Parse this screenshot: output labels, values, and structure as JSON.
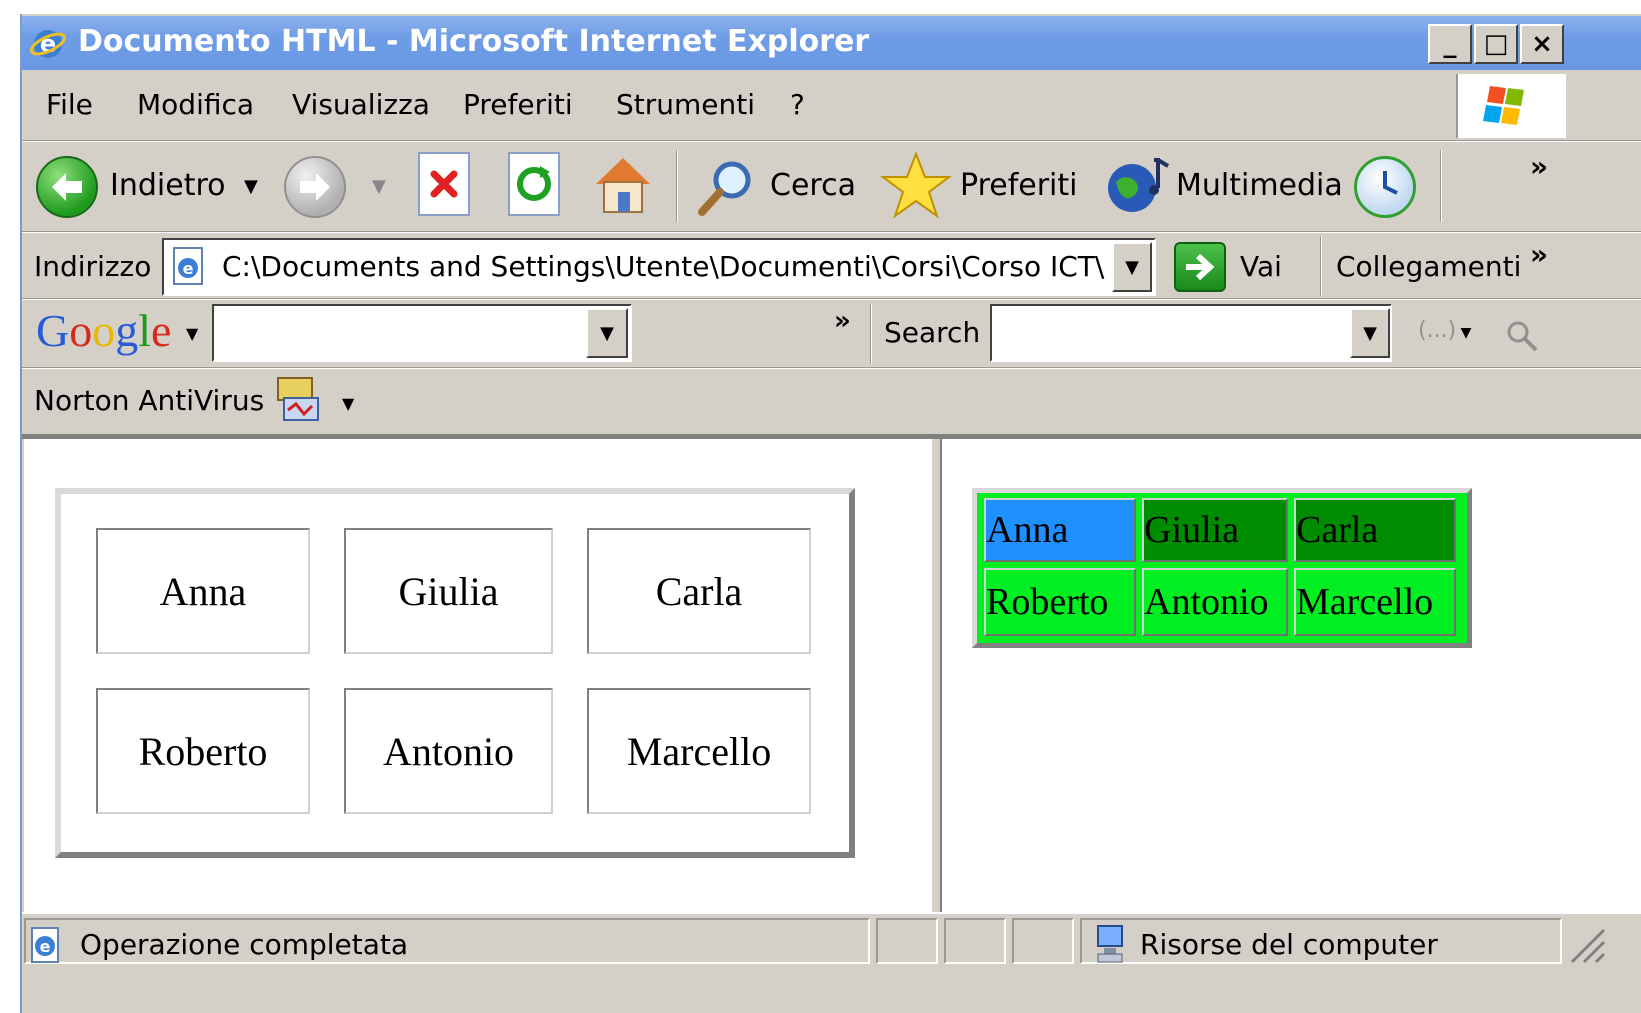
{
  "window": {
    "title": "Documento HTML - Microsoft Internet Explorer",
    "minimize_glyph": "_",
    "maximize_glyph": "□",
    "close_glyph": "×"
  },
  "menu": [
    "File",
    "Modifica",
    "Visualizza",
    "Preferiti",
    "Strumenti",
    "?"
  ],
  "toolbar": {
    "back_label": "Indietro",
    "search_label": "Cerca",
    "favorites_label": "Preferiti",
    "media_label": "Multimedia",
    "chevron": "»"
  },
  "address": {
    "label": "Indirizzo",
    "value": "C:\\Documents and Settings\\Utente\\Documenti\\Corsi\\Corso ICT\\C",
    "go_label": "Vai",
    "links_label": "Collegamenti",
    "chevron": "»"
  },
  "google_bar": {
    "logo_letters": [
      "G",
      "o",
      "o",
      "g",
      "l",
      "e"
    ],
    "search_label": "Search",
    "chevron": "»",
    "dots_label": "(...)"
  },
  "norton": {
    "label": "Norton AntiVirus"
  },
  "left_table": {
    "rows": [
      [
        "Anna",
        "Giulia",
        "Carla"
      ],
      [
        "Roberto",
        "Antonio",
        "Marcello"
      ]
    ]
  },
  "right_table": {
    "rows": [
      [
        "Anna",
        "Giulia",
        "Carla"
      ],
      [
        "Roberto",
        "Antonio",
        "Marcello"
      ]
    ],
    "colors": {
      "highlight": "#1e90ff",
      "dark_green": "#008c00",
      "light_green": "#00ee22"
    }
  },
  "status": {
    "text": "Operazione completata",
    "zone": "Risorse del computer"
  }
}
